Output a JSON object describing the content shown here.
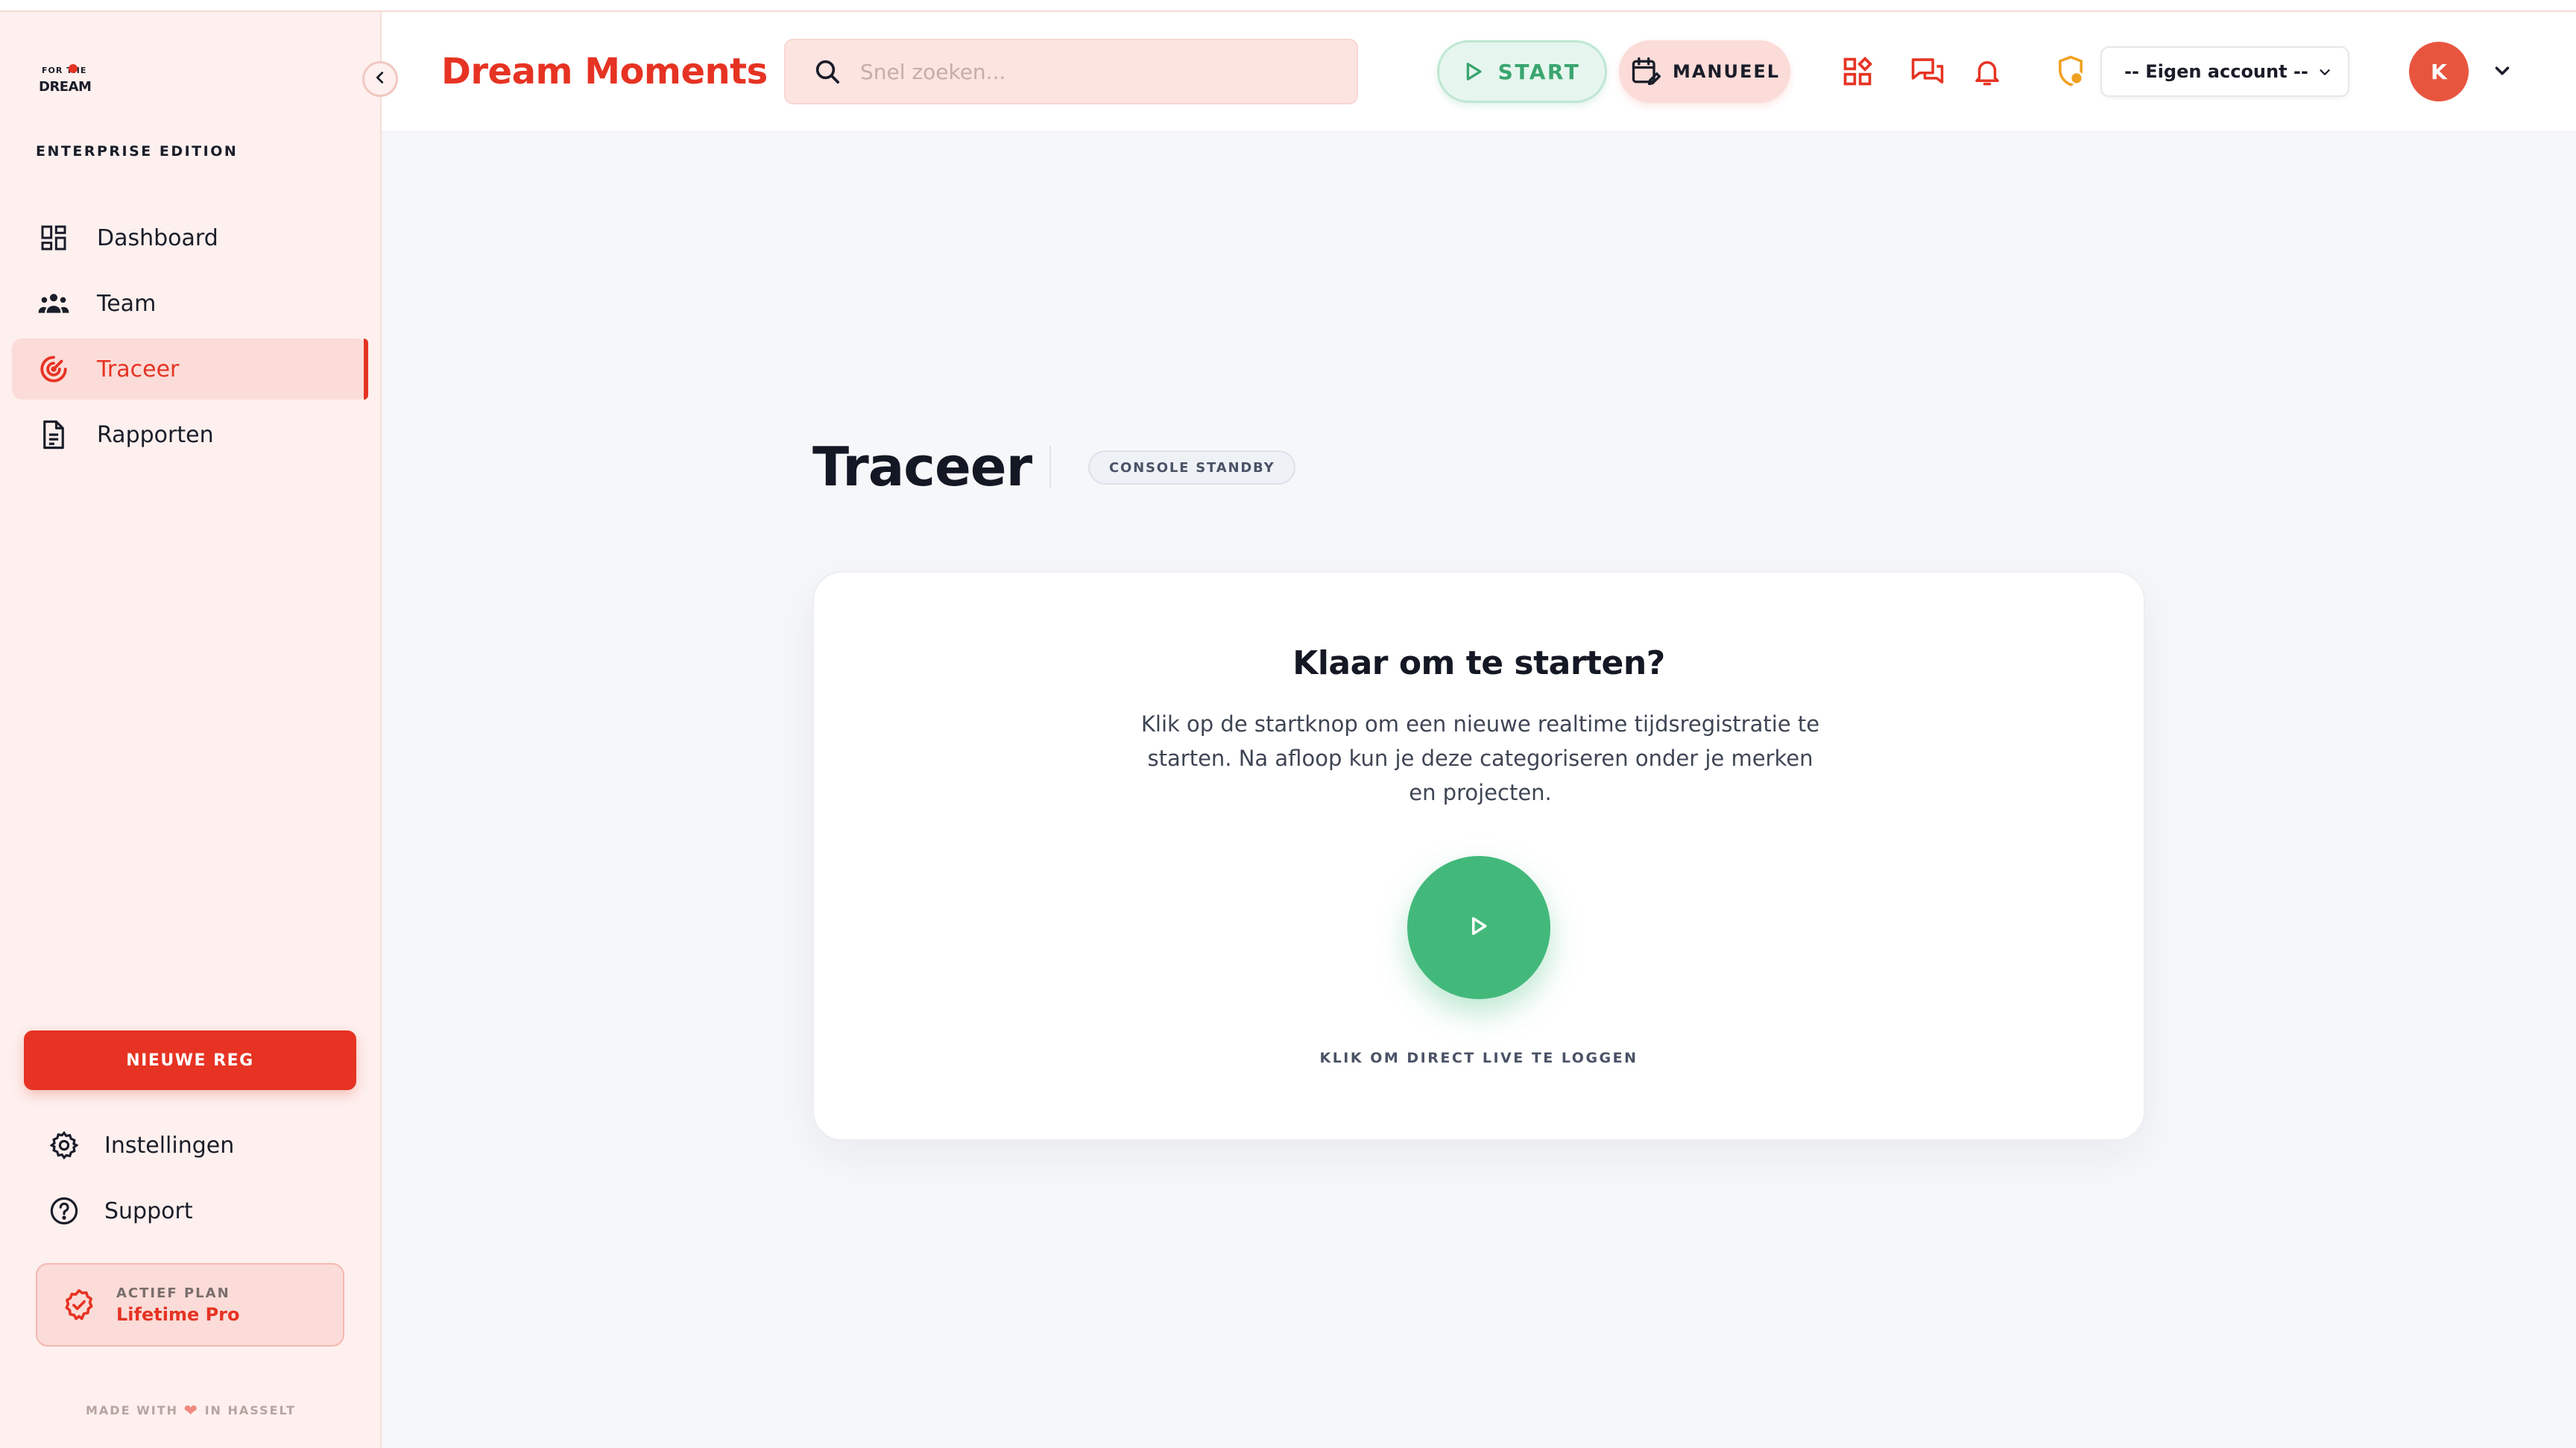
{
  "app": {
    "logo_text_small": "FOR THE",
    "logo_text_big": "DREAM",
    "edition": "ENTERPRISE EDITION",
    "brand": "Dream Moments",
    "accent_color": "#e63323",
    "success_color": "#42b97b"
  },
  "sidebar": {
    "items": [
      {
        "label": "Dashboard",
        "icon": "dashboard-icon",
        "active": false
      },
      {
        "label": "Team",
        "icon": "team-icon",
        "active": false
      },
      {
        "label": "Traceer",
        "icon": "target-icon",
        "active": true
      },
      {
        "label": "Rapporten",
        "icon": "document-icon",
        "active": false
      }
    ],
    "new_reg_label": "NIEUWE REG",
    "bottom_items": [
      {
        "label": "Instellingen",
        "icon": "gear-icon"
      },
      {
        "label": "Support",
        "icon": "help-icon"
      }
    ],
    "plan": {
      "label": "ACTIEF PLAN",
      "name": "Lifetime Pro"
    },
    "footer_prefix": "MADE WITH",
    "footer_suffix": "IN HASSELT"
  },
  "header": {
    "search_placeholder": "Snel zoeken...",
    "start_label": "START",
    "manual_label": "MANUEEL",
    "account_select": "-- Eigen account --",
    "avatar_initial": "K"
  },
  "main": {
    "title": "Traceer",
    "status_badge": "CONSOLE STANDBY",
    "card": {
      "title": "Klaar om te starten?",
      "text": "Klik op de startknop om een nieuwe realtime tijdsregistratie te starten. Na afloop kun je deze categoriseren onder je merken en projecten.",
      "caption": "KLIK OM DIRECT LIVE TE LOGGEN"
    }
  }
}
